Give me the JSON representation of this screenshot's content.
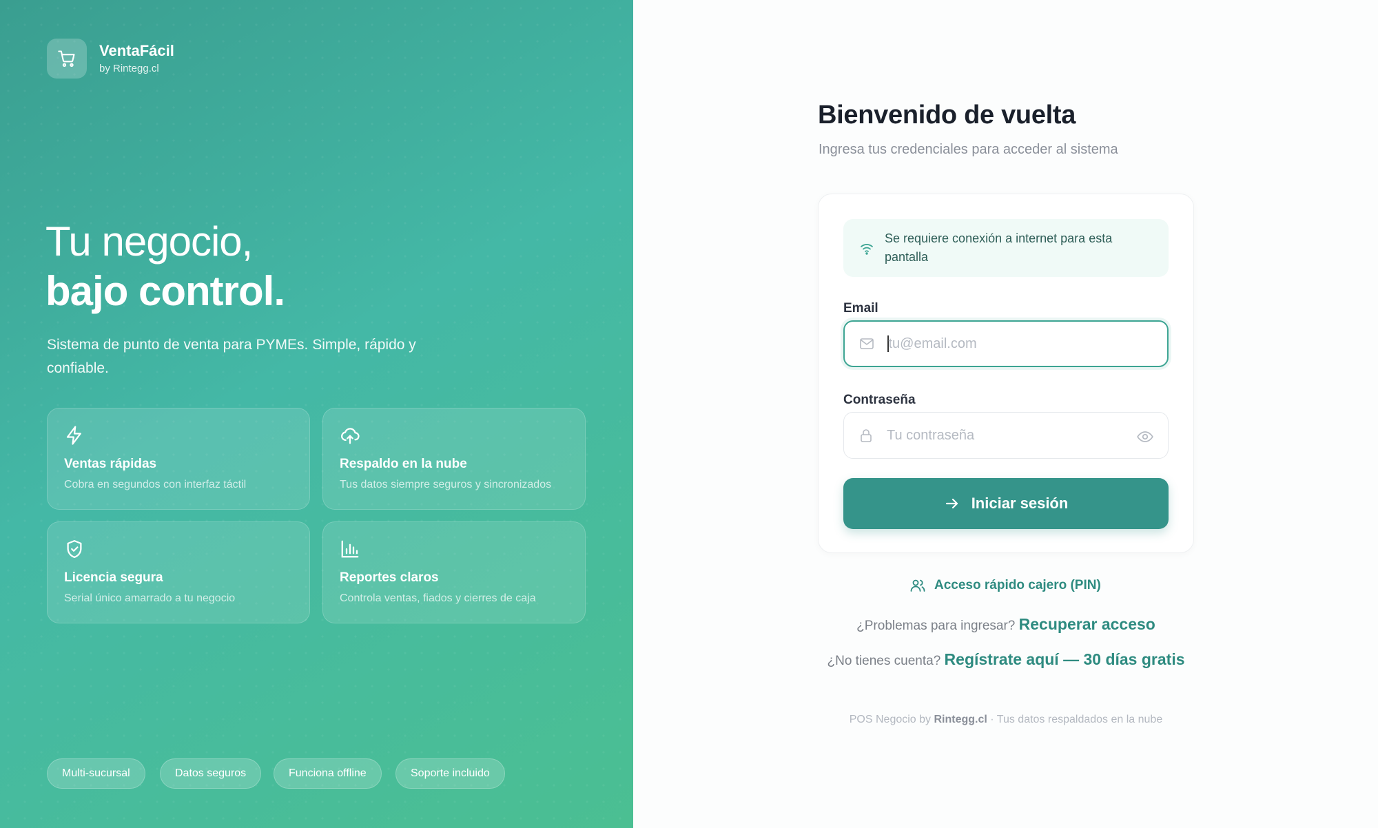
{
  "brand": {
    "name": "VentaFácil",
    "sub": "by Rintegg.cl",
    "icon": "shopping-cart-icon"
  },
  "hero": {
    "line1": "Tu negocio,",
    "line2": "bajo control.",
    "description": "Sistema de punto de venta para PYMEs. Simple, rápido y confiable."
  },
  "features": [
    {
      "icon": "lightning-icon",
      "title": "Ventas rápidas",
      "desc": "Cobra en segundos con interfaz táctil"
    },
    {
      "icon": "cloud-upload-icon",
      "title": "Respaldo en la nube",
      "desc": "Tus datos siempre seguros y sincronizados"
    },
    {
      "icon": "shield-check-icon",
      "title": "Licencia segura",
      "desc": "Serial único amarrado a tu negocio"
    },
    {
      "icon": "bar-chart-icon",
      "title": "Reportes claros",
      "desc": "Controla ventas, fiados y cierres de caja"
    }
  ],
  "chips": [
    "Multi-sucursal",
    "Datos seguros",
    "Funciona offline",
    "Soporte incluido"
  ],
  "login": {
    "title": "Bienvenido de vuelta",
    "subtitle": "Ingresa tus credenciales para acceder al sistema",
    "notice": "Se requiere conexión a internet para esta pantalla",
    "email_label": "Email",
    "email_placeholder": "tu@email.com",
    "password_label": "Contraseña",
    "password_placeholder": "Tu contraseña",
    "submit": "Iniciar sesión"
  },
  "links": {
    "pin": "Acceso rápido cajero (PIN)",
    "problems_text": "¿Problemas para ingresar?",
    "recover": "Recuperar acceso",
    "no_account_text": "¿No tienes cuenta?",
    "register": "Regístrate aquí — 30 días gratis"
  },
  "footer": {
    "prefix": "POS Negocio by",
    "brand": "Rintegg.cl",
    "suffix": "· Tus datos respaldados en la nube"
  },
  "colors": {
    "accent": "#35948a",
    "gradient_start": "#3a9e90",
    "gradient_end": "#4bbf92"
  }
}
